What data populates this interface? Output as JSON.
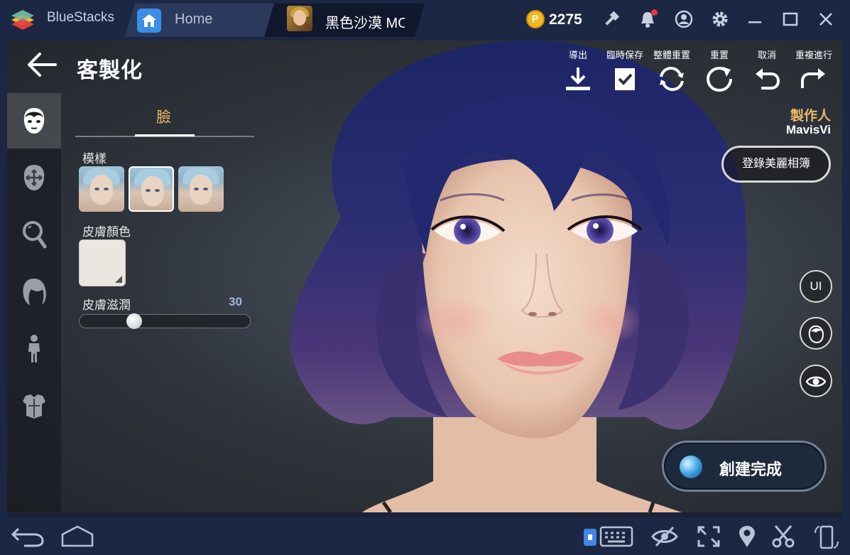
{
  "titlebar": {
    "app_name": "BlueStacks",
    "tabs": [
      {
        "label": "Home"
      },
      {
        "label": "黑色沙漠 MOBILE"
      }
    ],
    "coins": "2275",
    "coin_symbol": "P"
  },
  "panel": {
    "title": "客製化",
    "face_tab": "臉",
    "style_label": "模樣",
    "skin_color_label": "皮膚顏色",
    "skin_moisture_label": "皮膚滋潤",
    "skin_moisture_value": "30",
    "skin_moisture_fraction": 0.3,
    "skin_color": "#ebe6df"
  },
  "actions": {
    "export": "導出",
    "temp_save": "臨時保存",
    "reset_all": "整體重置",
    "reset": "重置",
    "undo": "取消",
    "redo": "重複進行"
  },
  "maker": {
    "title": "製作人",
    "name": "MavisVi"
  },
  "album_button": "登錄美麗相簿",
  "ui_toggle": "UI",
  "create_button": "創建完成",
  "colors": {
    "accent_gold": "#e8b96a",
    "chrome": "#1c2744",
    "hair": "#2b2f7a"
  }
}
